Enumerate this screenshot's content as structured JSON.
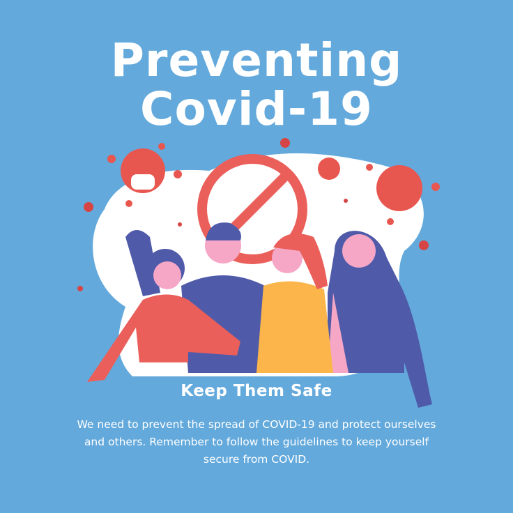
{
  "title_line1": "Preventing",
  "title_line2": "Covid-19",
  "subtitle": "Keep Them Safe",
  "body": "We need to prevent the spread of COVID-19 and protect ourselves and others. Remember to follow the guidelines to keep yourself secure from COVID.",
  "colors": {
    "background": "#63a9dc",
    "virus": "#e8574f",
    "text": "#ffffff"
  }
}
